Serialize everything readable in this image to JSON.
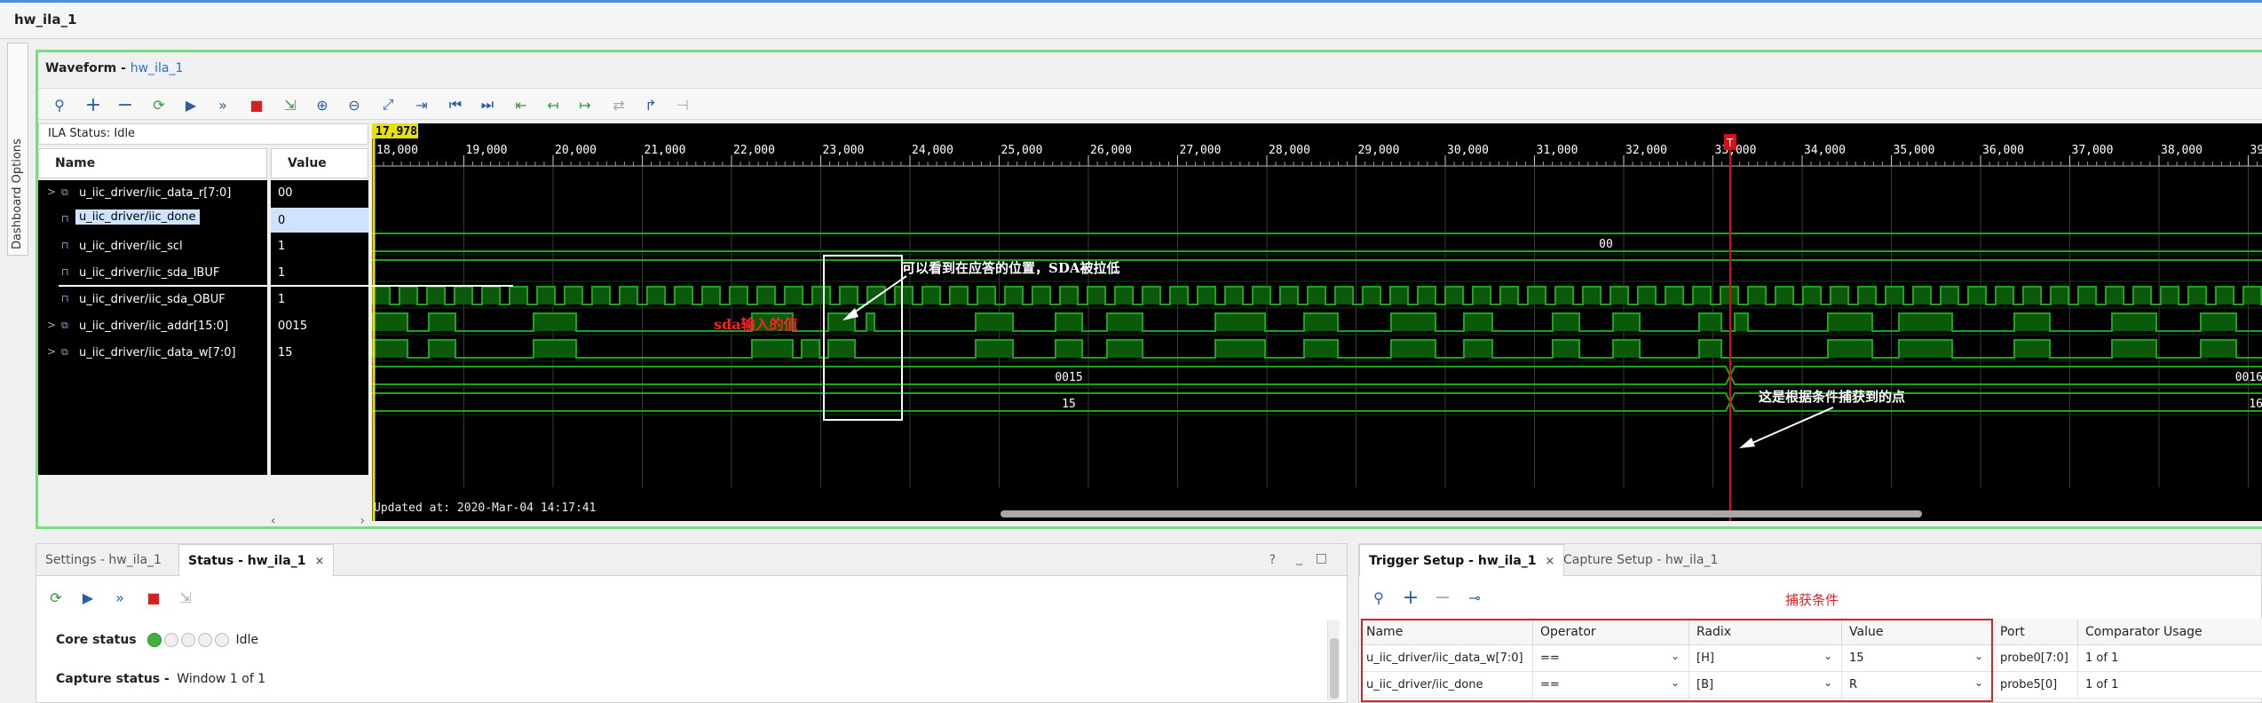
{
  "window": {
    "title": "hw_ila_1"
  },
  "sidebar": {
    "dashboard_options": "Dashboard Options"
  },
  "waveform": {
    "title": "Waveform - ",
    "title_link": "hw_ila_1",
    "ila_status_label": "ILA Status:",
    "ila_status_value": "Idle",
    "col_name": "Name",
    "col_value": "Value",
    "cursor_value": "17,978",
    "trigger_marker": "T",
    "updated_at": "Updated at: 2020-Mar-04 14:17:41",
    "timeline_ticks": [
      "18,000",
      "19,000",
      "20,000",
      "21,000",
      "22,000",
      "23,000",
      "24,000",
      "25,000",
      "26,000",
      "27,000",
      "28,000",
      "29,000",
      "30,000",
      "31,000",
      "32,000",
      "33,000",
      "34,000",
      "35,000",
      "36,000",
      "37,000",
      "38,000",
      "39"
    ],
    "signals": [
      {
        "name": "u_iic_driver/iic_data_r[7:0]",
        "value": "00",
        "bus": true,
        "bus_label": "00"
      },
      {
        "name": "u_iic_driver/iic_done",
        "value": "0",
        "bus": false,
        "selected": true
      },
      {
        "name": "u_iic_driver/iic_scl",
        "value": "1",
        "bus": false
      },
      {
        "name": "u_iic_driver/iic_sda_IBUF",
        "value": "1",
        "bus": false
      },
      {
        "name": "u_iic_driver/iic_sda_OBUF",
        "value": "1",
        "bus": false
      },
      {
        "name": "u_iic_driver/iic_addr[15:0]",
        "value": "0015",
        "bus": true,
        "bus_label": "0015",
        "bus_label_right": "0016"
      },
      {
        "name": "u_iic_driver/iic_data_w[7:0]",
        "value": "15",
        "bus": true,
        "bus_label": "15",
        "bus_label_right": "16"
      }
    ],
    "annotations": {
      "ack_note": "可以看到在应答的位置，SDA被拉低",
      "sda_note": "sda输入的值",
      "trigger_note": "这是根据条件捕获到的点"
    }
  },
  "bottom_left": {
    "tabs": [
      {
        "label": "Settings - hw_ila_1",
        "active": false
      },
      {
        "label": "Status - hw_ila_1",
        "active": true,
        "closable": "×"
      }
    ],
    "help": "?",
    "core_status_label": "Core status",
    "core_status_value": "Idle",
    "capture_status_label": "Capture status -",
    "capture_status_value": "Window 1 of 1"
  },
  "bottom_right": {
    "tabs": [
      {
        "label": "Trigger Setup - hw_ila_1",
        "active": true,
        "closable": "×"
      },
      {
        "label": "Capture Setup - hw_ila_1",
        "active": false
      }
    ],
    "capture_condition_note": "捕获条件",
    "columns": [
      "Name",
      "Operator",
      "Radix",
      "Value",
      "Port",
      "Comparator Usage"
    ],
    "rows": [
      {
        "name": "u_iic_driver/iic_data_w[7:0]",
        "operator": "==",
        "radix": "[H]",
        "value": "15",
        "port": "probe0[7:0]",
        "usage": "1 of 1"
      },
      {
        "name": "u_iic_driver/iic_done",
        "operator": "==",
        "radix": "[B]",
        "value": "R",
        "port": "probe5[0]",
        "usage": "1 of 1"
      }
    ]
  },
  "colors": {
    "wave_green": "#1fa31f",
    "wave_fill": "#0b5a0b",
    "cursor_yellow": "#e8e000",
    "trigger_red": "#d8101a",
    "annotation_red": "#ff2020",
    "panel_border": "#7ddc7d"
  }
}
